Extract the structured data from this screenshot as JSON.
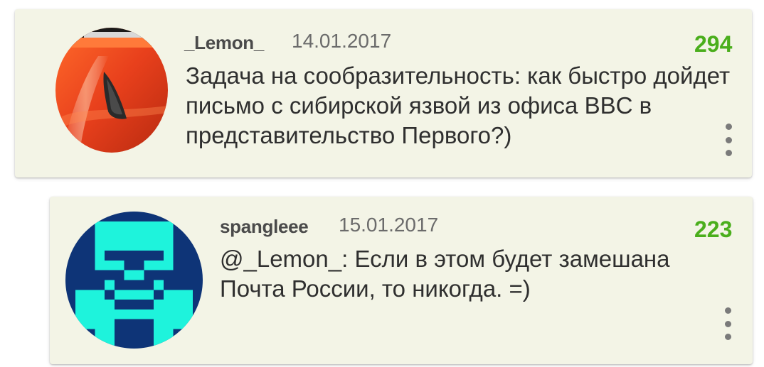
{
  "comments": [
    {
      "author": "_Lemon_",
      "date": "14.01.2017",
      "rating": "294",
      "text": "Задача на сообразительность: как быстро дойдет письмо с сибирской язвой из офиса BBC в представительство Первого?)",
      "avatar_icon": "car-photo-avatar"
    },
    {
      "author": "spangleee",
      "date": "15.01.2017",
      "rating": "223",
      "text": "@_Lemon_: Если в этом будет замешана Почта России, то никогда. =)",
      "avatar_icon": "pixel-monster-avatar"
    }
  ],
  "colors": {
    "card_bg": "#f3f4e6",
    "rating": "#4aae1c",
    "avatar2_bg": "#0e3477",
    "avatar2_fg": "#1ef3dc",
    "avatar1_red": "#e8401c"
  },
  "icons": {
    "menu": "more-vertical-icon"
  }
}
